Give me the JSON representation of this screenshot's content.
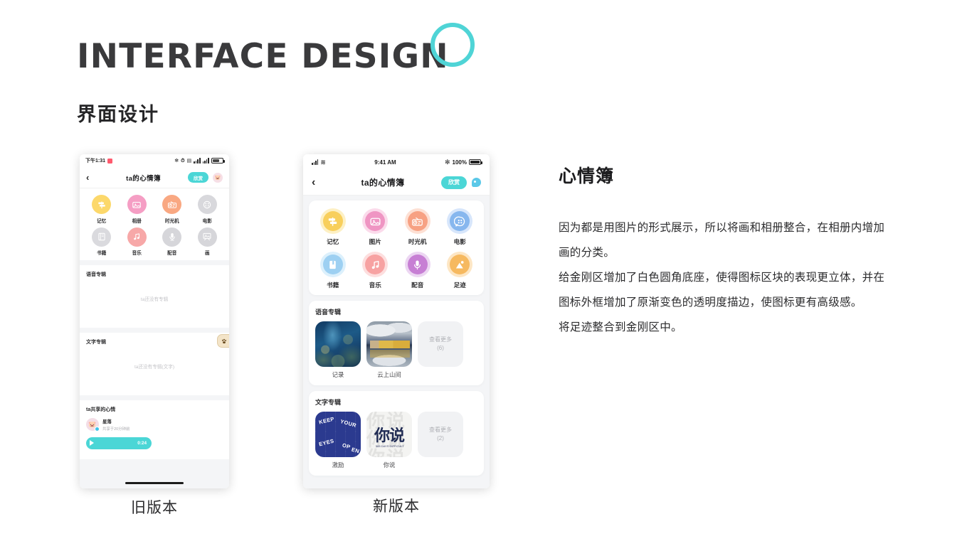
{
  "header": {
    "title": "INTERFACE DESIGN",
    "subtitle": "界面设计",
    "ring_color": "#4fd4d6"
  },
  "captions": {
    "old": "旧版本",
    "new": "新版本"
  },
  "old_phone": {
    "status": {
      "time": "下午1:31",
      "icons": [
        "bluetooth-icon",
        "alarm-icon",
        "sim-icon",
        "signal-icon",
        "signal2-icon",
        "battery-icon"
      ]
    },
    "nav": {
      "back": "‹",
      "title": "ta的心情簿",
      "pill": "欣赏",
      "avatar": "avatar-icon"
    },
    "grid": [
      {
        "label": "记忆",
        "color": "#fcd86b",
        "icon": "signpost-icon"
      },
      {
        "label": "相册",
        "color": "#f59ec4",
        "icon": "photo-icon"
      },
      {
        "label": "时光机",
        "color": "#f9a882",
        "icon": "radio-icon"
      },
      {
        "label": "电影",
        "color": "#d8d8dc",
        "icon": "film-icon"
      },
      {
        "label": "书籍",
        "color": "#dadade",
        "icon": "book-icon"
      },
      {
        "label": "音乐",
        "color": "#f7a8a8",
        "icon": "music-icon"
      },
      {
        "label": "配音",
        "color": "#d6d6da",
        "icon": "mic-icon"
      },
      {
        "label": "画",
        "color": "#d6d6da",
        "icon": "easel-icon"
      }
    ],
    "voice_album": {
      "title": "语音专辑",
      "empty": "ta还没有专辑"
    },
    "text_album": {
      "title": "文字专辑",
      "empty": "ta还没有专辑(文字)"
    },
    "paw_button": "paw-icon",
    "shared": {
      "title": "ta共享的心情",
      "name": "星落",
      "time": "共享于20分钟前",
      "duration": "0:24",
      "player_color": "#4bd6d6"
    }
  },
  "new_phone": {
    "status": {
      "time": "9:41 AM",
      "battery_pct": "100%",
      "icons": [
        "signal-icon",
        "wifi-icon",
        "bluetooth-icon",
        "battery-icon"
      ]
    },
    "nav": {
      "back": "‹",
      "title": "ta的心情簿",
      "pill": "欣赏",
      "avatar": "bird-icon"
    },
    "grid": [
      {
        "label": "记忆",
        "core": "#f8cf5c",
        "ring": "#fdf0c4",
        "icon": "signpost-icon"
      },
      {
        "label": "图片",
        "core": "#ef95c3",
        "ring": "#fbdbeb",
        "icon": "photo-icon"
      },
      {
        "label": "时光机",
        "core": "#f7a183",
        "ring": "#fde0d4",
        "icon": "radio-icon"
      },
      {
        "label": "电影",
        "core": "#87b7ee",
        "ring": "#d7e6fb",
        "icon": "film-icon"
      },
      {
        "label": "书籍",
        "core": "#9dd0f2",
        "ring": "#dcf0fc",
        "icon": "book-icon"
      },
      {
        "label": "音乐",
        "core": "#f7a2a2",
        "ring": "#fddede",
        "icon": "music-icon"
      },
      {
        "label": "配音",
        "core": "#c77fd4",
        "ring": "#ecd6f2",
        "icon": "mic-icon"
      },
      {
        "label": "足迹",
        "core": "#f6b960",
        "ring": "#fde6c4",
        "icon": "mountain-icon"
      }
    ],
    "voice_album": {
      "title": "语音专辑",
      "items": [
        {
          "label": "记录",
          "art": "underwater-art"
        },
        {
          "label": "云上山间",
          "art": "golden-temple-art"
        }
      ],
      "more_label": "查看更多",
      "more_count": "(6)"
    },
    "text_album": {
      "title": "文字专辑",
      "items": [
        {
          "label": "激励",
          "art": "keep-your-eyes-open-art",
          "words": [
            "KEEP",
            "YOUR",
            "EYES",
            "OP",
            "EN"
          ]
        },
        {
          "label": "你说",
          "art": "ni-shuo-art",
          "big": "你说",
          "tiny": "365\nDAYS\nDIFFICULT"
        }
      ],
      "more_label": "查看更多",
      "more_count": "(2)"
    }
  },
  "description": {
    "title": "心情簿",
    "paragraphs": [
      "因为都是用图片的形式展示，所以将画和相册整合，在相册内增加画的分类。",
      "给金刚区增加了白色圆角底座，使得图标区块的表现更立体，并在图标外框增加了原渐变色的透明度描边，使图标更有高级感。",
      "将足迹整合到金刚区中。"
    ]
  }
}
